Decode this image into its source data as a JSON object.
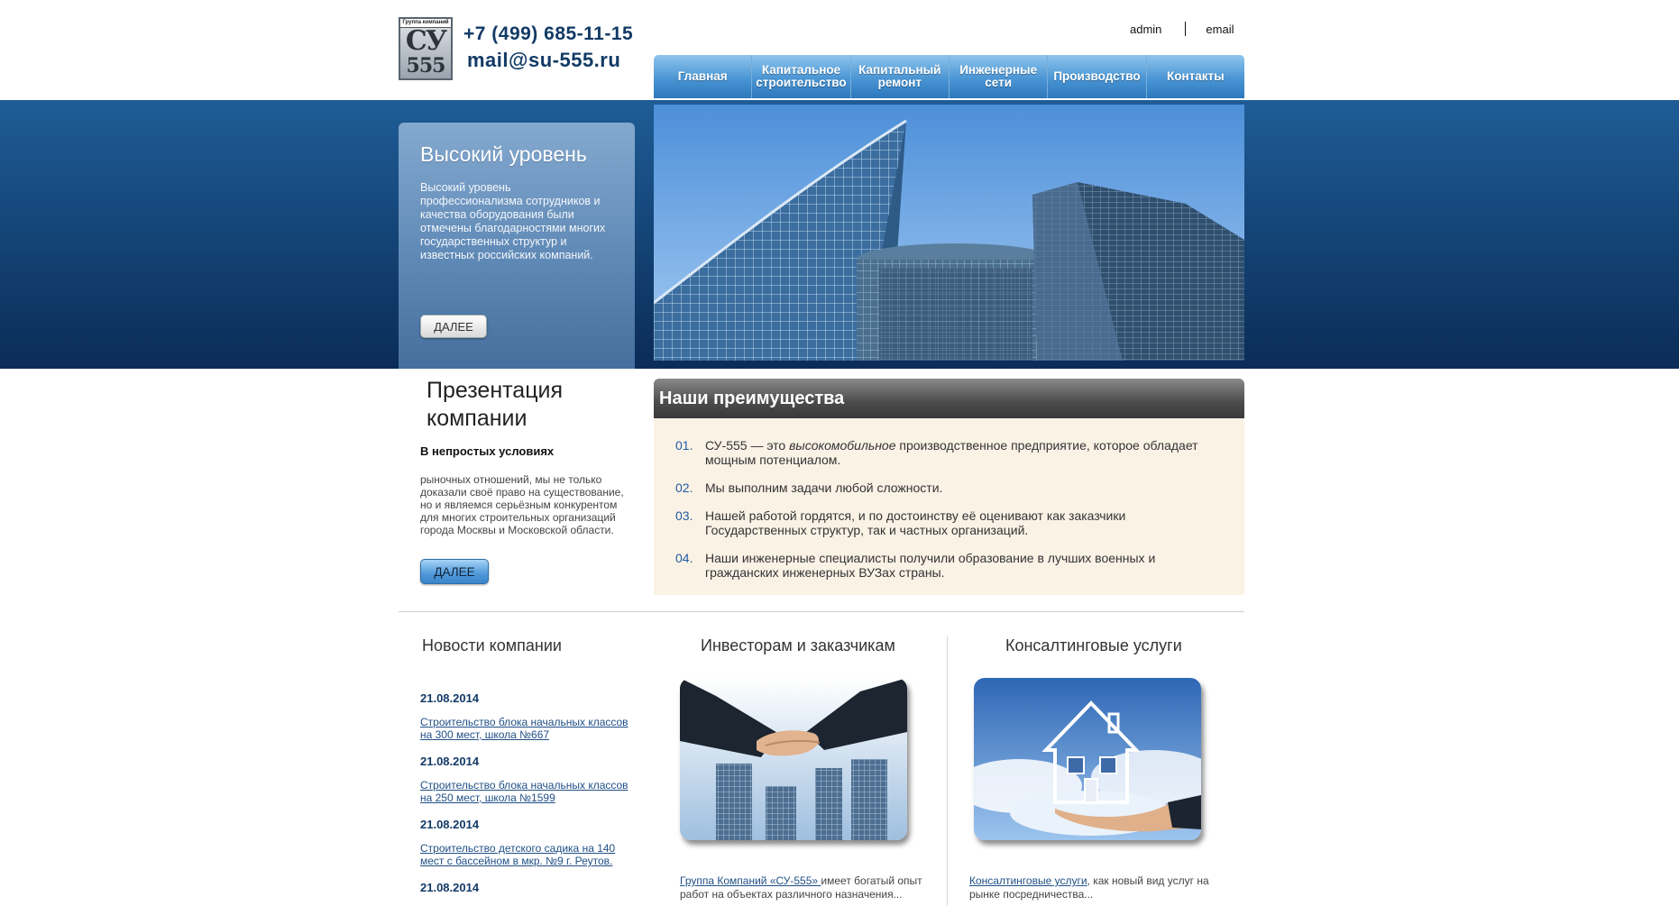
{
  "header": {
    "logo_caption": "Группа компаний",
    "logo_mark_1": "СУ",
    "logo_mark_2": "555",
    "phone": "+7 (499) 685-11-15",
    "email": "mail@su-555.ru",
    "top_links": [
      "admin",
      "email"
    ]
  },
  "nav": [
    "Главная",
    "Капитальное строительство",
    "Капитальный ремонт",
    "Инженерные сети",
    "Производство",
    "Контакты"
  ],
  "hero": {
    "title": "Высокий уровень",
    "text": "Высокий уровень профессионализма сотрудников и качества оборудования были отмечены благодарностями многих государственных структур и известных российских компаний.",
    "button": "ДАЛЕЕ"
  },
  "presentation": {
    "title": "Презентация компании",
    "subtitle": "В непростых условиях",
    "text": "рыночных отношений, мы не только доказали своё право на существование, но и являемся серьёзным конкурентом для многих строительных организаций города Москвы и Московской области.",
    "button": "ДАЛЕЕ"
  },
  "advantages": {
    "title": "Наши преимущества",
    "items": [
      {
        "num": "01.",
        "pre": "СУ-555 — это ",
        "em": "высокомобильное",
        "post": " производственное предприятие, которое обладает мощным потенциалом."
      },
      {
        "num": "02.",
        "pre": "Мы выполним задачи любой сложности.",
        "em": "",
        "post": ""
      },
      {
        "num": "03.",
        "pre": "Нашей работой гордятся, и по достоинству её оценивают как заказчики Государственных структур, так и  частных организаций.",
        "em": "",
        "post": ""
      },
      {
        "num": "04.",
        "pre": "Наши инженерные специалисты получили образование в лучших военных и гражданских инженерных ВУЗах страны.",
        "em": "",
        "post": ""
      }
    ]
  },
  "news": {
    "title": "Новости компании",
    "items": [
      {
        "date": "21.08.2014",
        "text": "Строительство блока начальных классов на 300 мест, школа №667"
      },
      {
        "date": "21.08.2014",
        "text": "Строительство блока начальных классов на 250 мест, школа №1599"
      },
      {
        "date": "21.08.2014",
        "text": "Строительство детского садика на 140 мест с бассейном в мкр. №9 г. Реутов."
      },
      {
        "date": "21.08.2014",
        "text": ""
      }
    ]
  },
  "investors": {
    "title": "Инвесторам и заказчикам",
    "link": "Группа Компаний «СУ-555» ",
    "text": "имеет богатый опыт работ на объектах различного назначения..."
  },
  "consulting": {
    "title": "Консалтинговые услуги",
    "link": "Консалтинговые услуги",
    "text": ", как новый вид услуг на рынке посредничества..."
  }
}
